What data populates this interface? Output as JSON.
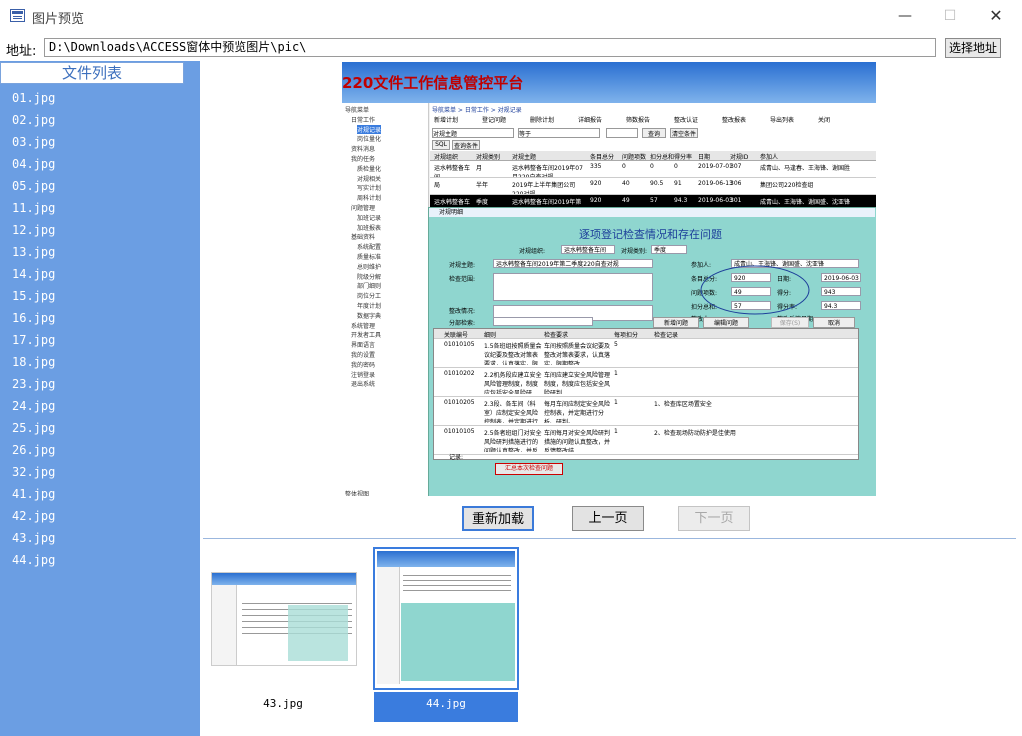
{
  "window": {
    "title": "图片预览",
    "minimize": "—",
    "maximize": "☐",
    "close": "✕"
  },
  "address": {
    "label": "地址:",
    "value": "D:\\Downloads\\ACCESS窗体中预览图片\\pic\\",
    "choose_label": "选择地址"
  },
  "sidebar": {
    "header": "文件列表",
    "files": [
      "01.jpg",
      "02.jpg",
      "03.jpg",
      "04.jpg",
      "05.jpg",
      "11.jpg",
      "12.jpg",
      "13.jpg",
      "14.jpg",
      "15.jpg",
      "16.jpg",
      "17.jpg",
      "18.jpg",
      "23.jpg",
      "24.jpg",
      "25.jpg",
      "26.jpg",
      "32.jpg",
      "41.jpg",
      "42.jpg",
      "43.jpg",
      "44.jpg"
    ]
  },
  "preview": {
    "banner_title": "220文件工作信息管控平台",
    "nav": [
      "导航菜单",
      "日常工作",
      "对规记录",
      "岗位量化",
      "资料消息",
      "我的任务",
      "质检量化",
      "对规相关",
      "写实计划",
      "周科计划",
      "问题管理",
      "加班记录",
      "加班报表",
      "基础资料",
      "系统配置",
      "质量标准",
      "总则维护",
      "院级分解",
      "部门细则",
      "岗位分工",
      "年度计划",
      "数据字典",
      "系统管理",
      "开发者工具",
      "界面语言",
      "我的设置",
      "我的密码",
      "注销登录",
      "退出系统",
      "整体视图"
    ],
    "breadcrumb": "导航菜单 > 日常工作 > 对规记录",
    "toolbar": [
      "新增计划",
      "登记问题",
      "删除计划",
      "详细报告",
      "筛数报告",
      "整改认证",
      "整改报表",
      "导出列表",
      "关闭"
    ],
    "filter": {
      "field": "对规主题",
      "op": "等于",
      "query_btn": "查询",
      "clear_btn": "清空条件"
    },
    "sql_tab": "SQL",
    "cond_tab": "查询条件",
    "table_headers": [
      "对规组织",
      "对规类别",
      "对规主题",
      "条目总分",
      "问题项数",
      "扣分总和",
      "得分率",
      "日期",
      "对规ID",
      "参加人"
    ],
    "rows": [
      [
        "运水韩整备车间",
        "月",
        "运水韩整备车间2019年07月220自查对规",
        "335",
        "0",
        "0",
        "0",
        "2019-07-01",
        "307",
        "成青山、马逢春、王海锋、谢国胜"
      ],
      [
        "局",
        "半年",
        "2019年上半年集团公司220对规",
        "920",
        "40",
        "90.5",
        "91",
        "2019-06-13",
        "306",
        "集团公司220检查组"
      ],
      [
        "运水韩整备车间",
        "季度",
        "运水韩整备车间2019年第二",
        "920",
        "49",
        "57",
        "94.3",
        "2019-06-03",
        "301",
        "成青山、王海锋、谢国盛、沈亚锋"
      ]
    ],
    "dialog": {
      "window_label": "对规明细",
      "title": "逐项登记检查情况和存在问题",
      "org_label": "对规组织:",
      "org_value": "运水韩整备车间",
      "type_label": "对规类别:",
      "type_value": "季度",
      "topic_label": "对规主题:",
      "topic_value": "运水韩整备车间2019年第二季度220自查对规",
      "participants_label": "参加人:",
      "participants_value": "成青山、王海锋、谢国盛、沈亚锋",
      "scope_label": "检查范围:",
      "rectify_label": "整改情况:",
      "total_label": "条目总分:",
      "total_value": "920",
      "date_label": "日期:",
      "date_value": "2019-06-03",
      "issues_label": "问题项数:",
      "issues_value": "49",
      "score_label": "得分:",
      "score_value": "943",
      "deduct_label": "扣分总和:",
      "deduct_value": "57",
      "rate_label": "得分率:",
      "rate_value": "94.3",
      "rectifier_label": "整改人:",
      "rectify_date_label": "整改反馈日期:",
      "category_label": "分部检索:",
      "add_issue_btn": "新增问题",
      "edit_issue_btn": "编辑问题",
      "save_btn": "保存(S)",
      "cancel_btn": "取消",
      "detail_headers": [
        "关联编号",
        "细则",
        "检查要求",
        "每项扣分",
        "检查记录"
      ],
      "detail_rows": [
        [
          "01010105",
          "1.5各班组按照质量会议纪要及整改对策表要求，认真落实，限期整改",
          "车间按照质量会议纪要及整改对策表要求，认真落实，限期整改",
          "5",
          ""
        ],
        [
          "01010202",
          "2.2机务段应建立安全风险管理制度，制度应包括安全风险研判、研判、评估办法",
          "车间应建立安全风险管理制度，制度应包括安全风险研判",
          "1",
          ""
        ],
        [
          "01010205",
          "2.3段、各车间（科室）应制定安全风险控制表，并定期进行分析、研判。",
          "每月车间应制定安全风险控制表，并定期进行分析、研判。",
          "1",
          "1、检查库区场置安全"
        ],
        [
          "01010105",
          "2.5各者班组门对安全风险研判措施进行的问题认真整改，并反馈整改结果",
          "车间每月对安全风险研判措施的问题认真整改，并反馈整改结",
          "1",
          "2、检查现场防动防护是佳使用"
        ]
      ],
      "record_label": "记录:",
      "summary_btn": "汇总本次检查问题"
    }
  },
  "buttons": {
    "reload": "重新加载",
    "prev": "上一页",
    "next": "下一页"
  },
  "thumbnails": [
    {
      "label": "43.jpg",
      "selected": false
    },
    {
      "label": "44.jpg",
      "selected": true
    }
  ]
}
